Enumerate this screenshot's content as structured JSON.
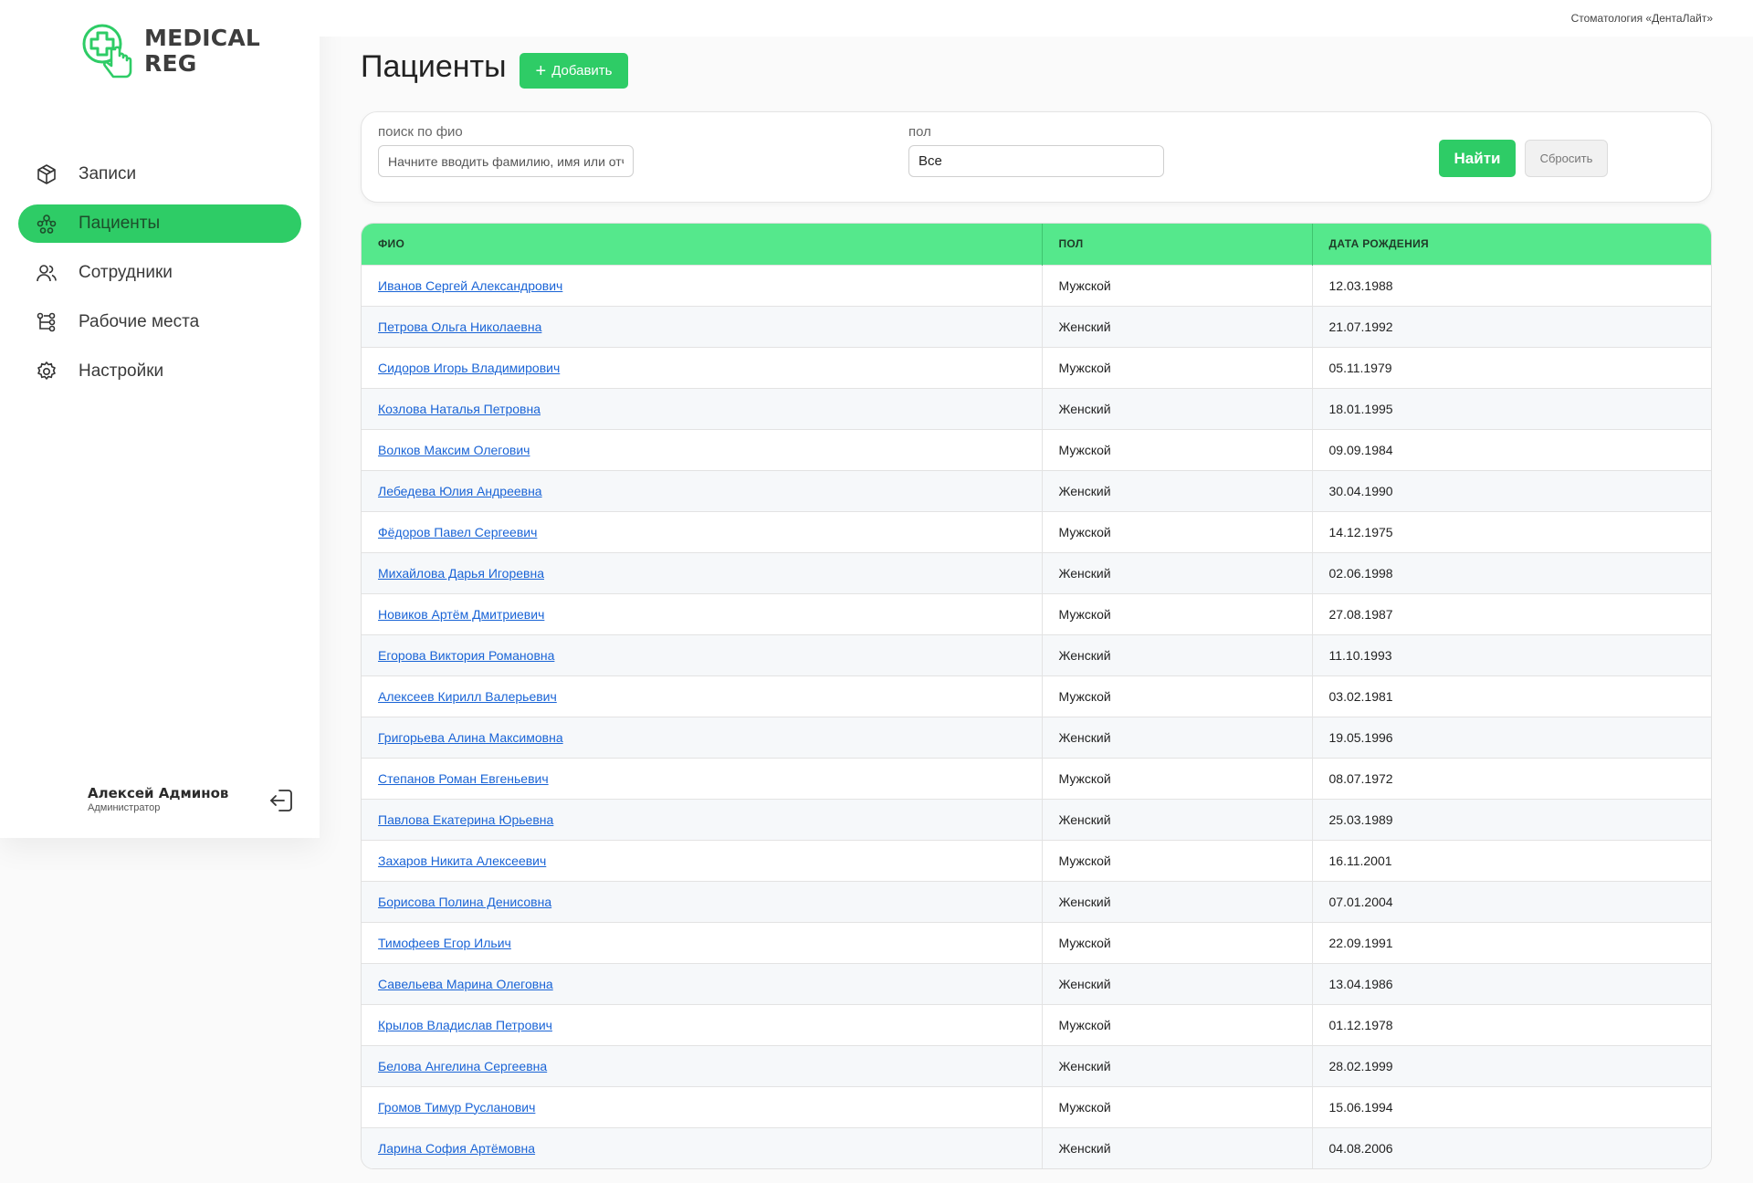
{
  "brand": {
    "line1": "MEDICAL",
    "line2": "REG",
    "accent": "#2ecc66"
  },
  "clinic": "Стоматология «ДентаЛайт»",
  "sidebar": {
    "items": [
      {
        "label": "Записи",
        "icon": "box-icon",
        "active": false
      },
      {
        "label": "Пациенты",
        "icon": "patients-icon",
        "active": true
      },
      {
        "label": "Сотрудники",
        "icon": "users-icon",
        "active": false
      },
      {
        "label": "Рабочие места",
        "icon": "workplace-tree-icon",
        "active": false
      },
      {
        "label": "Настройки",
        "icon": "gear-icon",
        "active": false
      }
    ]
  },
  "user": {
    "name": "Алексей Админов",
    "role": "Администратор",
    "logout_icon": "logout-icon"
  },
  "page": {
    "title": "Пациенты",
    "add_label": "Добавить"
  },
  "filter": {
    "search_label": "поиск по фио",
    "search_placeholder": "Начните вводить фамилию, имя или отчество",
    "search_value": "",
    "gender_label": "пол",
    "gender_value": "Все",
    "find_label": "Найти",
    "reset_label": "Сбросить"
  },
  "table": {
    "headers": [
      "ФИО",
      "ПОЛ",
      "ДАТА РОЖДЕНИЯ"
    ],
    "rows": [
      [
        "Иванов Сергей Александрович",
        "Мужской",
        "12.03.1988"
      ],
      [
        "Петрова Ольга Николаевна",
        "Женский",
        "21.07.1992"
      ],
      [
        "Сидоров Игорь Владимирович",
        "Мужской",
        "05.11.1979"
      ],
      [
        "Козлова Наталья Петровна",
        "Женский",
        "18.01.1995"
      ],
      [
        "Волков Максим Олегович",
        "Мужской",
        "09.09.1984"
      ],
      [
        "Лебедева Юлия Андреевна",
        "Женский",
        "30.04.1990"
      ],
      [
        "Фёдоров Павел Сергеевич",
        "Мужской",
        "14.12.1975"
      ],
      [
        "Михайлова Дарья Игоревна",
        "Женский",
        "02.06.1998"
      ],
      [
        "Новиков Артём Дмитриевич",
        "Мужской",
        "27.08.1987"
      ],
      [
        "Егорова Виктория Романовна",
        "Женский",
        "11.10.1993"
      ],
      [
        "Алексеев Кирилл Валерьевич",
        "Мужской",
        "03.02.1981"
      ],
      [
        "Григорьева Алина Максимовна",
        "Женский",
        "19.05.1996"
      ],
      [
        "Степанов Роман Евгеньевич",
        "Мужской",
        "08.07.1972"
      ],
      [
        "Павлова Екатерина Юрьевна",
        "Женский",
        "25.03.1989"
      ],
      [
        "Захаров Никита Алексеевич",
        "Мужской",
        "16.11.2001"
      ],
      [
        "Борисова Полина Денисовна",
        "Женский",
        "07.01.2004"
      ],
      [
        "Тимофеев Егор Ильич",
        "Мужской",
        "22.09.1991"
      ],
      [
        "Савельева Марина Олеговна",
        "Женский",
        "13.04.1986"
      ],
      [
        "Крылов Владислав Петрович",
        "Мужской",
        "01.12.1978"
      ],
      [
        "Белова Ангелина Сергеевна",
        "Женский",
        "28.02.1999"
      ],
      [
        "Громов Тимур Русланович",
        "Мужской",
        "15.06.1994"
      ],
      [
        "Ларина София Артёмовна",
        "Женский",
        "04.08.2006"
      ]
    ]
  }
}
